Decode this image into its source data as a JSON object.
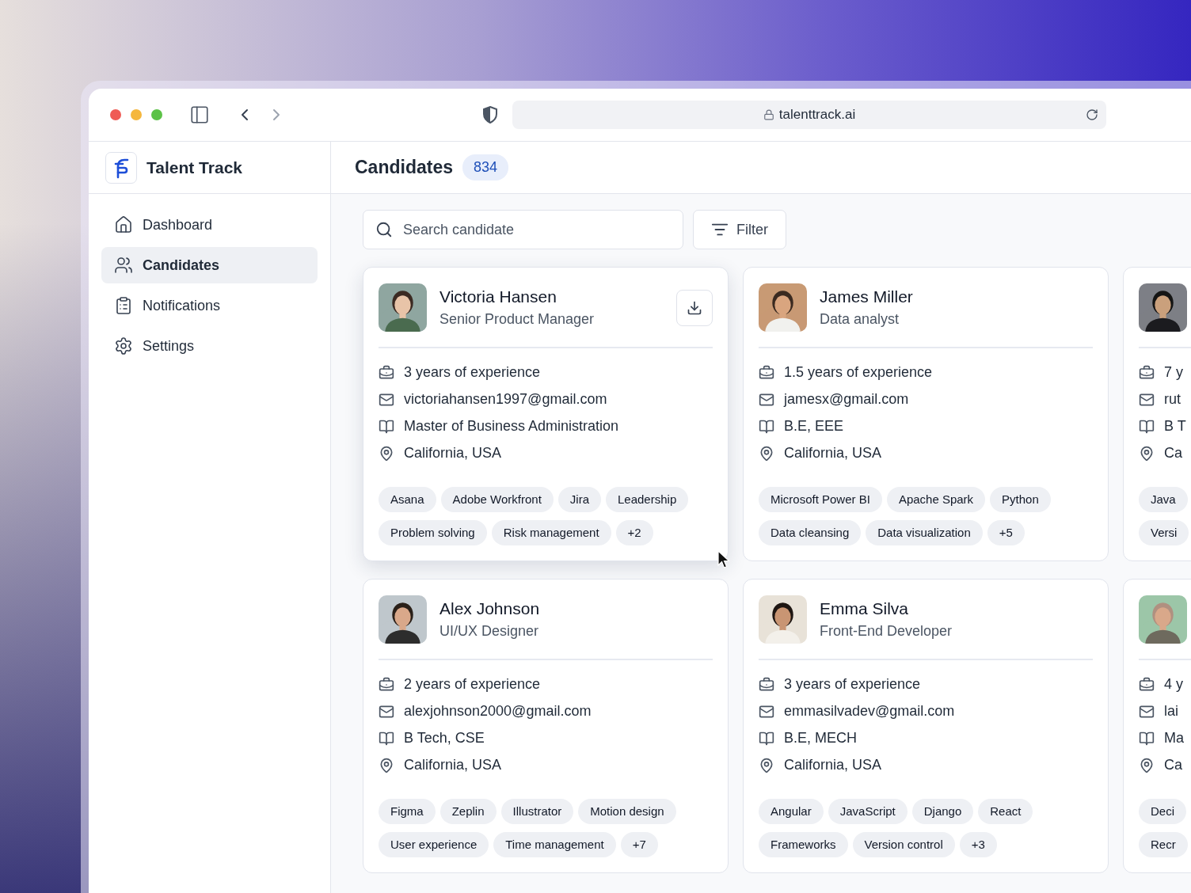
{
  "browser": {
    "url": "talenttrack.ai"
  },
  "sidebar": {
    "brand": "Talent Track",
    "items": [
      {
        "label": "Dashboard",
        "selected": false
      },
      {
        "label": "Candidates",
        "selected": true
      },
      {
        "label": "Notifications",
        "selected": false
      },
      {
        "label": "Settings",
        "selected": false
      }
    ]
  },
  "header": {
    "title": "Candidates",
    "count": "834"
  },
  "search": {
    "placeholder": "Search candidate"
  },
  "filter_button": "Filter",
  "candidates": [
    {
      "name": "Victoria Hansen",
      "role": "Senior Product Manager",
      "hovered": true,
      "experience": "3 years of experience",
      "email": "victoriahansen1997@gmail.com",
      "education": "Master of Business Administration",
      "location": "California, USA",
      "skill_rows": [
        [
          "Asana",
          "Adobe Workfront",
          "Jira",
          "Leadership"
        ],
        [
          "Problem solving",
          "Risk management",
          "+2"
        ]
      ]
    },
    {
      "name": "James Miller",
      "role": "Data analyst",
      "hovered": false,
      "experience": "1.5 years of experience",
      "email": "jamesx@gmail.com",
      "education": "B.E, EEE",
      "location": "California, USA",
      "skill_rows": [
        [
          "Microsoft Power BI",
          "Apache Spark",
          "Python"
        ],
        [
          "Data cleansing",
          "Data visualization",
          "+5"
        ]
      ]
    },
    {
      "hovered": false,
      "experience": "7 y",
      "email": "rut",
      "education": "B T",
      "location": "Ca",
      "skill_rows": [
        [
          "Java"
        ],
        [
          "Versi"
        ]
      ]
    },
    {
      "name": "Alex Johnson",
      "role": "UI/UX Designer",
      "hovered": false,
      "experience": "2 years of experience",
      "email": "alexjohnson2000@gmail.com",
      "education": "B Tech, CSE",
      "location": "California, USA",
      "skill_rows": [
        [
          "Figma",
          "Zeplin",
          "Illustrator",
          "Motion design"
        ],
        [
          "User experience",
          "Time management",
          "+7"
        ]
      ]
    },
    {
      "name": "Emma Silva",
      "role": "Front-End Developer",
      "hovered": false,
      "experience": "3 years of experience",
      "email": "emmasilvadev@gmail.com",
      "education": "B.E, MECH",
      "location": "California, USA",
      "skill_rows": [
        [
          "Angular",
          "JavaScript",
          "Django",
          "React"
        ],
        [
          "Frameworks",
          "Version control",
          "+3"
        ]
      ]
    },
    {
      "hovered": false,
      "experience": "4 y",
      "email": "lai",
      "education": "Ma",
      "location": "Ca",
      "skill_rows": [
        [
          "Deci"
        ],
        [
          "Recr"
        ]
      ]
    }
  ]
}
